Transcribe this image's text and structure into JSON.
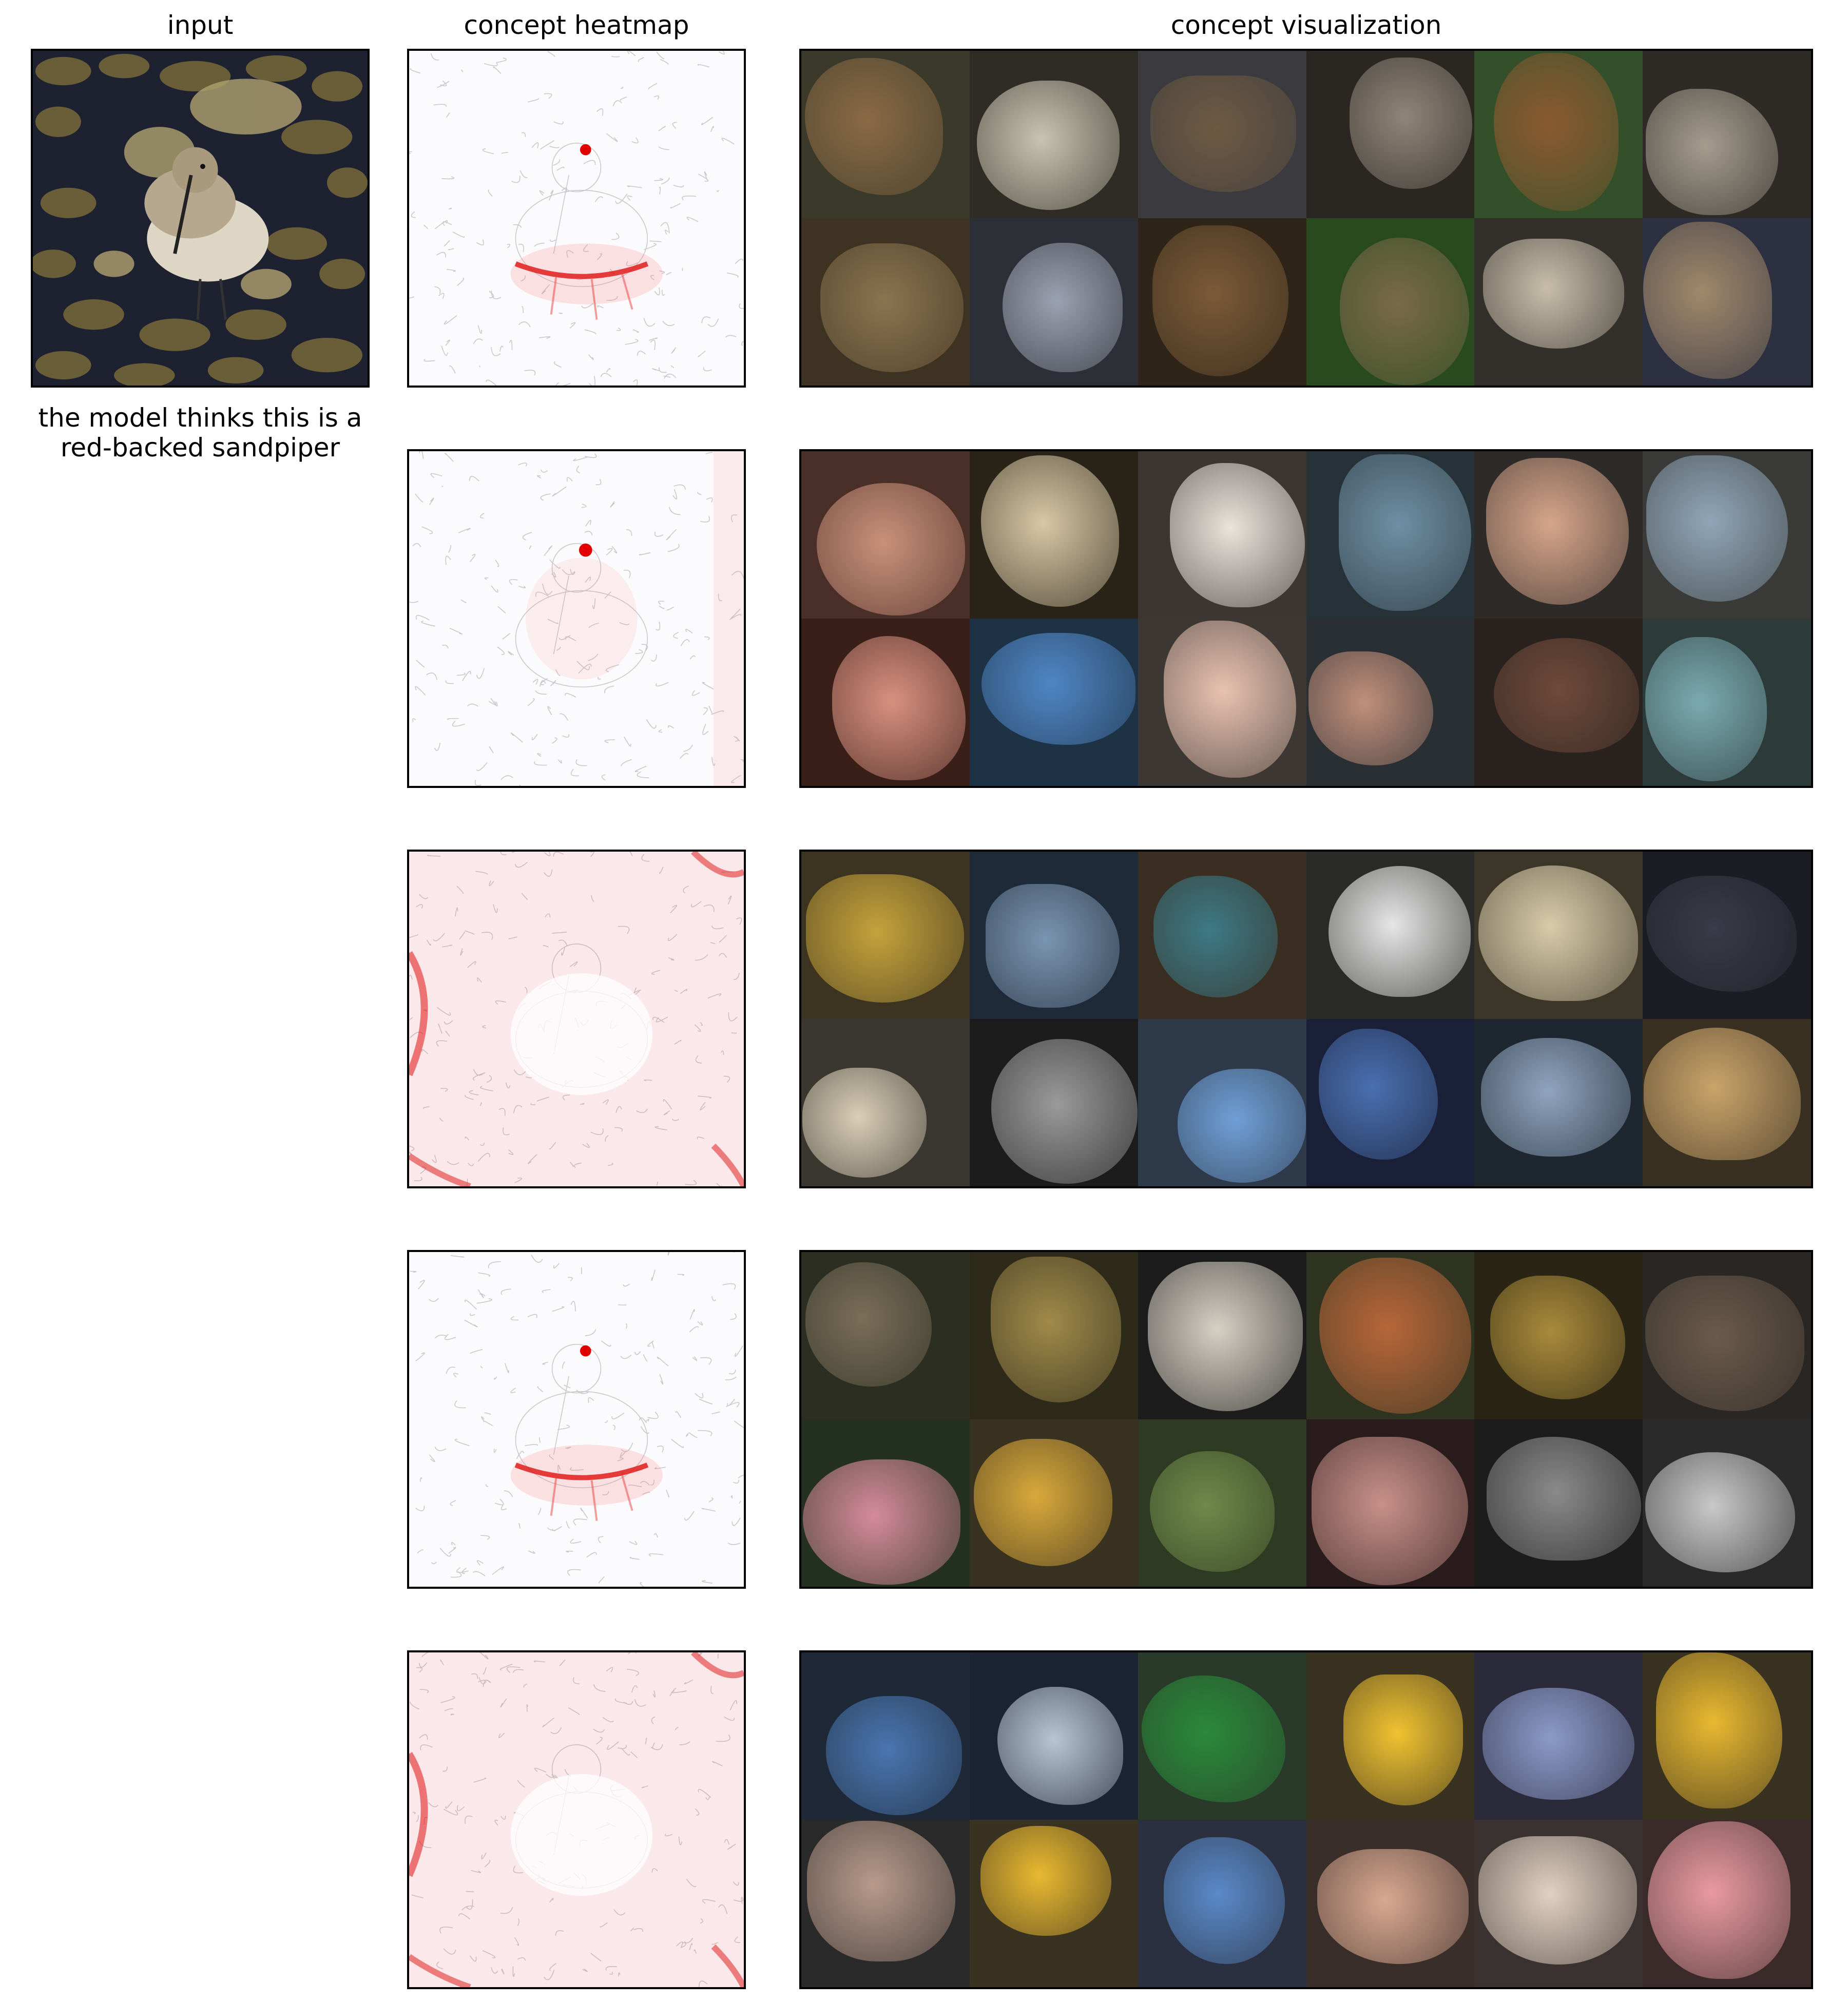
{
  "headers": {
    "input": "input",
    "heatmap": "concept heatmap",
    "visualization": "concept visualization"
  },
  "caption": "the model thinks this is a red-backed sandpiper",
  "rows": [
    {
      "id": "concept-1",
      "heat_focus": "bird-body",
      "tiles": [
        {
          "bg": "#3b3a2a",
          "fg": "#8a6a45"
        },
        {
          "bg": "#2e2c24",
          "fg": "#c9c3b0"
        },
        {
          "bg": "#3a3a3f",
          "fg": "#6e5a42"
        },
        {
          "bg": "#2a2622",
          "fg": "#8f8579"
        },
        {
          "bg": "#33502a",
          "fg": "#8a5a30"
        },
        {
          "bg": "#2e2b27",
          "fg": "#a59c8e"
        },
        {
          "bg": "#3e3222",
          "fg": "#8b7450"
        },
        {
          "bg": "#2c2f36",
          "fg": "#9aa1b0"
        },
        {
          "bg": "#2e2418",
          "fg": "#7a5a38"
        },
        {
          "bg": "#284a1e",
          "fg": "#7a6a48"
        },
        {
          "bg": "#33302c",
          "fg": "#c7bda9"
        },
        {
          "bg": "#2d3040",
          "fg": "#a0886a"
        }
      ]
    },
    {
      "id": "concept-2",
      "heat_focus": "eye",
      "tiles": [
        {
          "bg": "#4a2e28",
          "fg": "#c9907a"
        },
        {
          "bg": "#2a2418",
          "fg": "#d8c7a6"
        },
        {
          "bg": "#3c3630",
          "fg": "#e9e4dc"
        },
        {
          "bg": "#263238",
          "fg": "#6f8fa4"
        },
        {
          "bg": "#2e2a28",
          "fg": "#d6a58a"
        },
        {
          "bg": "#3a3a38",
          "fg": "#8fa6b8"
        },
        {
          "bg": "#3a1e18",
          "fg": "#d79080"
        },
        {
          "bg": "#1e3246",
          "fg": "#4f86c4"
        },
        {
          "bg": "#3e3834",
          "fg": "#e8c2b0"
        },
        {
          "bg": "#2a2f34",
          "fg": "#c08f7a"
        },
        {
          "bg": "#2a221e",
          "fg": "#6e4a3a"
        },
        {
          "bg": "#2c3a3a",
          "fg": "#7aaab0"
        }
      ]
    },
    {
      "id": "concept-3",
      "heat_focus": "background",
      "tiles": [
        {
          "bg": "#3c3420",
          "fg": "#c4a23a"
        },
        {
          "bg": "#1f2a38",
          "fg": "#7a95b0"
        },
        {
          "bg": "#3a2e22",
          "fg": "#3c7a86"
        },
        {
          "bg": "#2a2a28",
          "fg": "#e6e6e6"
        },
        {
          "bg": "#3c3628",
          "fg": "#d8cbaa"
        },
        {
          "bg": "#1c1c24",
          "fg": "#3a3a48"
        },
        {
          "bg": "#3a3630",
          "fg": "#d9ceb6"
        },
        {
          "bg": "#1c1c1c",
          "fg": "#9a9a9a"
        },
        {
          "bg": "#2e3a4a",
          "fg": "#6f9fd6"
        },
        {
          "bg": "#1a2038",
          "fg": "#4a70b0"
        },
        {
          "bg": "#1e2630",
          "fg": "#8fa4be"
        },
        {
          "bg": "#3a3022",
          "fg": "#c9a46a"
        }
      ]
    },
    {
      "id": "concept-4",
      "heat_focus": "legs",
      "tiles": [
        {
          "bg": "#2c2e22",
          "fg": "#7a6e58"
        },
        {
          "bg": "#2e2a1a",
          "fg": "#a08a4a"
        },
        {
          "bg": "#1c1c1c",
          "fg": "#d6d0c4"
        },
        {
          "bg": "#2e3420",
          "fg": "#b8663a"
        },
        {
          "bg": "#2a2414",
          "fg": "#a88a3a"
        },
        {
          "bg": "#2a2624",
          "fg": "#6a5a4a"
        },
        {
          "bg": "#243020",
          "fg": "#d48a9a"
        },
        {
          "bg": "#3a3220",
          "fg": "#d8a83a"
        },
        {
          "bg": "#2e3a22",
          "fg": "#6f8a4a"
        },
        {
          "bg": "#2a1c1c",
          "fg": "#c89088"
        },
        {
          "bg": "#1c1c1c",
          "fg": "#8a8a8a"
        },
        {
          "bg": "#2a2a2a",
          "fg": "#c8c8c8"
        }
      ]
    },
    {
      "id": "concept-5",
      "heat_focus": "texture",
      "tiles": [
        {
          "bg": "#1e2836",
          "fg": "#4a76b0"
        },
        {
          "bg": "#1c2434",
          "fg": "#b8c4d4"
        },
        {
          "bg": "#2a3a2a",
          "fg": "#2a8a3a"
        },
        {
          "bg": "#3a3220",
          "fg": "#f0c230"
        },
        {
          "bg": "#2a2a3a",
          "fg": "#8a9ac8"
        },
        {
          "bg": "#3a3220",
          "fg": "#e8b830"
        },
        {
          "bg": "#2a2a2a",
          "fg": "#b89a8a"
        },
        {
          "bg": "#3a3220",
          "fg": "#e8b830"
        },
        {
          "bg": "#2a3040",
          "fg": "#5a8ac8"
        },
        {
          "bg": "#3a2e2a",
          "fg": "#d8a890"
        },
        {
          "bg": "#3a3230",
          "fg": "#e0d0c0"
        },
        {
          "bg": "#3a2a2a",
          "fg": "#e89aa0"
        }
      ]
    }
  ]
}
